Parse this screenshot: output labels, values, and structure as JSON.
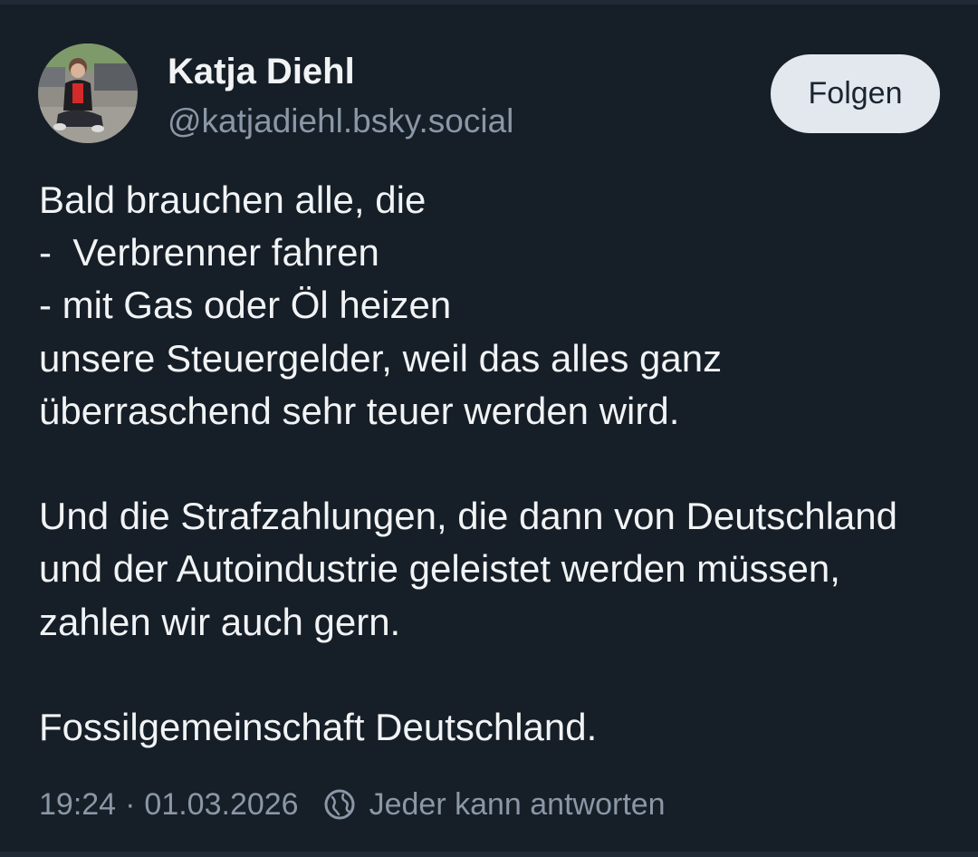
{
  "post": {
    "author": {
      "display_name": "Katja Diehl",
      "handle": "@katjadiehl.bsky.social"
    },
    "follow_label": "Folgen",
    "body": "Bald brauchen alle, die\n-  Verbrenner fahren\n- mit Gas oder Öl heizen\nunsere Steuergelder, weil das alles ganz überraschend sehr teuer werden wird.\n\nUnd die Strafzahlungen, die dann von Deutschland und der Autoindustrie geleistet werden müssen, zahlen wir auch gern.\n\nFossilgemeinschaft Deutschland.",
    "time": "19:24",
    "separator": "·",
    "date": "01.03.2026",
    "reply_setting": {
      "icon": "globe-icon",
      "label": "Jeder kann antworten"
    }
  },
  "colors": {
    "background": "#161e27",
    "text_primary": "#f1f3f5",
    "text_secondary": "#8a97a6",
    "follow_button_bg": "#e3e8ef",
    "follow_button_text": "#1b2530"
  }
}
